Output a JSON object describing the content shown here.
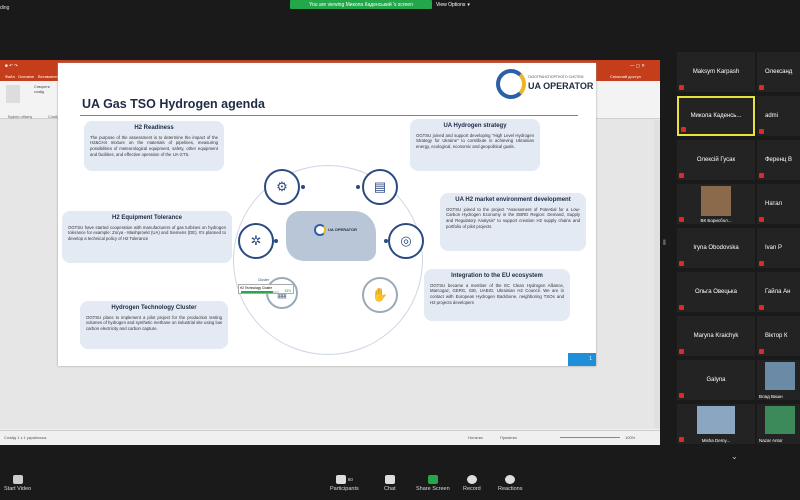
{
  "zoom": {
    "recording_label": "ding",
    "viewing_banner": "You are viewing Микола Каденський 's screen",
    "view_options": "View Options"
  },
  "ppt": {
    "title": "Презентація ОГТСУ.pptx - PowerPoint",
    "user_name": "Каденський Микола Ярославович",
    "shared_label": "Спільний доступ",
    "tabs": [
      "Файл",
      "Основне",
      "Вставлення",
      "Дизайн",
      "Переходи",
      "Анімація",
      "Слайд-шоу",
      "Рецензування",
      "Вид",
      "Що ви хочете зробити?"
    ],
    "ribbon_lines": [
      "Макет",
      "Скинути",
      "Розділ",
      "Вставити",
      "Створити",
      "слайд",
      "Упорядкувати",
      "Експрес-стилі",
      "Знайти",
      "Замінити",
      "Виділити"
    ],
    "ribbon_groups": [
      "Буфер обміну",
      "Слайди",
      "Шрифт",
      "Абзац",
      "Креслення",
      "Редагування"
    ],
    "status_left": "Слайд 1 з 1   українська",
    "status_notes": "Нотатки",
    "status_comments": "Примітки",
    "zoom_pct": "100%"
  },
  "slide": {
    "title": "UA Gas TSO Hydrogen agenda",
    "logo_small": "ГАЗОТРАНСПОРТНОГО СИСТЕМ",
    "logo_big": "UA OPERATOR",
    "cards": {
      "h2_readiness": {
        "title": "H2 Readiness",
        "text": "The purpose of the assessment is to determine the impact of the H2&CH4 mixture on the materials of pipelines, measuring possibilities of meteorological equipment, safety, other equipment and facilities, and effective operation of the UA GTS."
      },
      "equipment": {
        "title": "H2 Equipment Tolerance",
        "text": "OGTSU have started cooperation with manufacturers of gas turbines on hydrogen tolerance for example: Zorya - Mashproekt (UA) and Siemens (DE). It's planned to develop a technical policy of H2 Tolerance"
      },
      "cluster": {
        "title": "Hydrogen Technology Cluster",
        "text": "OGTSU plans to implement a pilot project for the production testing volumes of hydrogen and synthetic methane on industrial site using low carbon electricity and carbon capture."
      },
      "strategy": {
        "title": "UA Hydrogen strategy",
        "text": "OGTSU joined and support developing \"High Level Hydrogen Strategy for Ukraine\" to contribute in achieving Ukrainian energy, ecological, economic and geopolitical goals."
      },
      "market": {
        "title": "UA H2 market environment development",
        "text": "OGTSU joined to the project \"Assessment of Potential for a Low-Carbon Hydrogen Economy in the EBRD Region: Demand, Supply and Regulatory Analysis\" to support creation H2 supply chains and portfolio of pilot projects"
      },
      "integration": {
        "title": "Integration to the EU ecosystem",
        "text": "OGTSU became a member of the EC Clean Hydrogen Alliance, Marcogaz, GERG, GIE, UABIO, Ukrainian H2 Council. We are in contact with European Hydrogen Backbone, neighboring TSOs and H2 projects developers"
      }
    },
    "cluster_label": "Cluster",
    "tech_cluster_label": "H2 Technology Cluster",
    "tech_cluster_pct": "83%",
    "page_number": "1"
  },
  "gallery": [
    {
      "name": "Maksym Karpash"
    },
    {
      "name": "Олександ"
    },
    {
      "name": "Микола Каденсь..."
    },
    {
      "name": "admi"
    },
    {
      "name": "Олексій Гусак"
    },
    {
      "name": "Ференц В"
    },
    {
      "name": "ВК Борисбол..."
    },
    {
      "name": "Натал"
    },
    {
      "name": "Iryna Obodovska"
    },
    {
      "name": "Ivan P"
    },
    {
      "name": "Ольга Овецька"
    },
    {
      "name": "Гайла Ан"
    },
    {
      "name": "Maryna Kraichyk"
    },
    {
      "name": "Віктор К"
    },
    {
      "name": "Galyna"
    },
    {
      "name": "Влад Вишн"
    },
    {
      "name": "Misha Demy..."
    },
    {
      "name": "Nazar Antor"
    }
  ],
  "bottom": {
    "start_video": "Start Video",
    "participants": "Participants",
    "participants_count": "60",
    "chat": "Chat",
    "share_screen": "Share Screen",
    "record": "Record",
    "reactions": "Reactions"
  },
  "colors": {
    "ppt_red": "#c43e1c",
    "share_green": "#23a74a",
    "slide_navy": "#1f2a44",
    "card_bg": "#e3eaf3",
    "active_yellow": "#e8e338"
  }
}
